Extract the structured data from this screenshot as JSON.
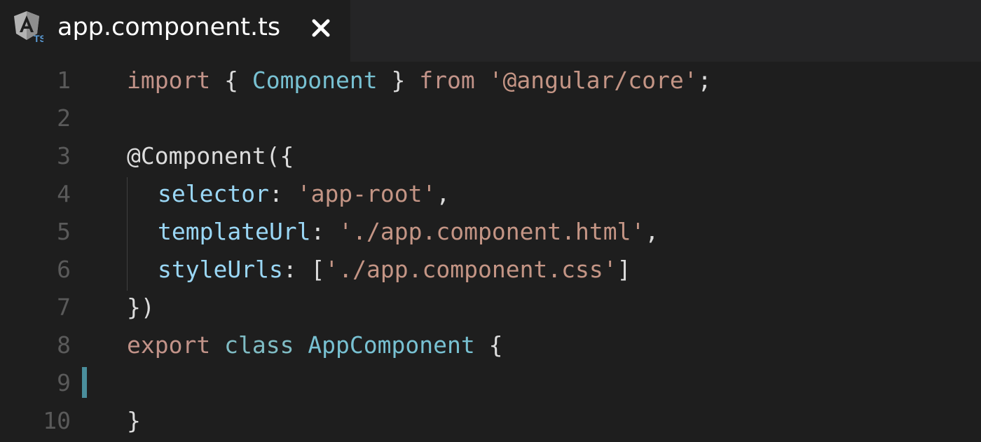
{
  "tab": {
    "title": "app.component.ts",
    "icon": "angular-typescript-icon",
    "close_glyph": "✖"
  },
  "editor": {
    "lines": [
      {
        "number": "1",
        "tokens": [
          "import",
          " { ",
          "Component",
          " } ",
          "from",
          " ",
          "'@angular/core'",
          ";"
        ]
      },
      {
        "number": "2",
        "tokens": []
      },
      {
        "number": "3",
        "tokens": [
          "@Component({"
        ]
      },
      {
        "number": "4",
        "tokens": [
          "selector",
          ": ",
          "'app-root'",
          ","
        ]
      },
      {
        "number": "5",
        "tokens": [
          "templateUrl",
          ": ",
          "'./app.component.html'",
          ","
        ]
      },
      {
        "number": "6",
        "tokens": [
          "styleUrls",
          ": [",
          "'./app.component.css'",
          "]"
        ]
      },
      {
        "number": "7",
        "tokens": [
          "})"
        ]
      },
      {
        "number": "8",
        "tokens": [
          "export",
          " ",
          "class",
          " ",
          "AppComponent",
          " {"
        ]
      },
      {
        "number": "9",
        "tokens": []
      },
      {
        "number": "10",
        "tokens": [
          "}"
        ]
      }
    ]
  },
  "colors": {
    "background": "#1e1e1e",
    "keyword": "#c29389",
    "string": "#c49585",
    "class_name": "#78c1d2",
    "property": "#9ad7f5",
    "line_number": "#5a5a5a",
    "modified_marker": "#4a8e9c"
  }
}
